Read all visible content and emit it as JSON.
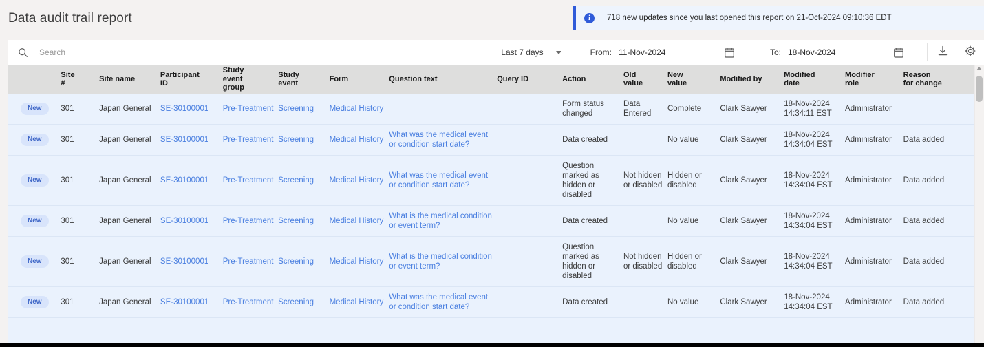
{
  "header": {
    "title": "Data audit trail report",
    "notification": {
      "icon": "info-icon",
      "text": "718 new updates since you last opened this report on 21-Oct-2024 09:10:36 EDT"
    }
  },
  "toolbar": {
    "search_placeholder": "Search",
    "search_value": "",
    "search_icon": "search-icon",
    "range_preset": "Last 7 days",
    "from_label": "From:",
    "from_value": "11-Nov-2024",
    "to_label": "To:",
    "to_value": "18-Nov-2024",
    "calendar_icon": "calendar-icon",
    "download_icon": "download-icon",
    "settings_icon": "gear-icon"
  },
  "table": {
    "columns": [
      "Site\n#",
      "Site name",
      "Participant\nID",
      "Study\nevent\ngroup",
      "Study\nevent",
      "Form",
      "Question text",
      "Query ID",
      "Action",
      "Old\nvalue",
      "New\nvalue",
      "Modified by",
      "Modified\ndate",
      "Modifier\nrole",
      "Reason\nfor change"
    ],
    "badge_label": "New",
    "rows": [
      {
        "badge": "New",
        "site": "301",
        "site_name": "Japan General",
        "participant_id": "SE-30100001",
        "study_event_group": "Pre-Treatment",
        "study_event": "Screening",
        "form": "Medical History",
        "question_text": "",
        "query_id": "",
        "action": "Form status changed",
        "old_value": "Data Entered",
        "new_value": "Complete",
        "modified_by": "Clark Sawyer",
        "modified_date": "18-Nov-2024 14:34:11 EST",
        "modifier_role": "Administrator",
        "reason_for_change": ""
      },
      {
        "badge": "New",
        "site": "301",
        "site_name": "Japan General",
        "participant_id": "SE-30100001",
        "study_event_group": "Pre-Treatment",
        "study_event": "Screening",
        "form": "Medical History",
        "question_text": "What was the medical event or condition start date?",
        "query_id": "",
        "action": "Data created",
        "old_value": "",
        "new_value": "No value",
        "modified_by": "Clark Sawyer",
        "modified_date": "18-Nov-2024 14:34:04 EST",
        "modifier_role": "Administrator",
        "reason_for_change": "Data added"
      },
      {
        "badge": "New",
        "site": "301",
        "site_name": "Japan General",
        "participant_id": "SE-30100001",
        "study_event_group": "Pre-Treatment",
        "study_event": "Screening",
        "form": "Medical History",
        "question_text": "What was the medical event or condition start date?",
        "query_id": "",
        "action": "Question marked as hidden or disabled",
        "old_value": "Not hidden or disabled",
        "new_value": "Hidden or disabled",
        "modified_by": "Clark Sawyer",
        "modified_date": "18-Nov-2024 14:34:04 EST",
        "modifier_role": "Administrator",
        "reason_for_change": "Data added"
      },
      {
        "badge": "New",
        "site": "301",
        "site_name": "Japan General",
        "participant_id": "SE-30100001",
        "study_event_group": "Pre-Treatment",
        "study_event": "Screening",
        "form": "Medical History",
        "question_text": "What is the medical condition or event term?",
        "query_id": "",
        "action": "Data created",
        "old_value": "",
        "new_value": "No value",
        "modified_by": "Clark Sawyer",
        "modified_date": "18-Nov-2024 14:34:04 EST",
        "modifier_role": "Administrator",
        "reason_for_change": "Data added"
      },
      {
        "badge": "New",
        "site": "301",
        "site_name": "Japan General",
        "participant_id": "SE-30100001",
        "study_event_group": "Pre-Treatment",
        "study_event": "Screening",
        "form": "Medical History",
        "question_text": "What is the medical condition or event term?",
        "query_id": "",
        "action": "Question marked as hidden or disabled",
        "old_value": "Not hidden or disabled",
        "new_value": "Hidden or disabled",
        "modified_by": "Clark Sawyer",
        "modified_date": "18-Nov-2024 14:34:04 EST",
        "modifier_role": "Administrator",
        "reason_for_change": "Data added"
      },
      {
        "badge": "New",
        "site": "301",
        "site_name": "Japan General",
        "participant_id": "SE-30100001",
        "study_event_group": "Pre-Treatment",
        "study_event": "Screening",
        "form": "Medical History",
        "question_text": "What was the medical event or condition start date?",
        "query_id": "",
        "action": "Data created",
        "old_value": "",
        "new_value": "No value",
        "modified_by": "Clark Sawyer",
        "modified_date": "18-Nov-2024 14:34:04 EST",
        "modifier_role": "Administrator",
        "reason_for_change": "Data added"
      }
    ]
  },
  "colors": {
    "accent": "#2f5bd9",
    "link": "#4a7fe0",
    "row_bg": "#eaf2fd",
    "header_bg": "#dededd",
    "page_bg": "#f4f2f1"
  }
}
